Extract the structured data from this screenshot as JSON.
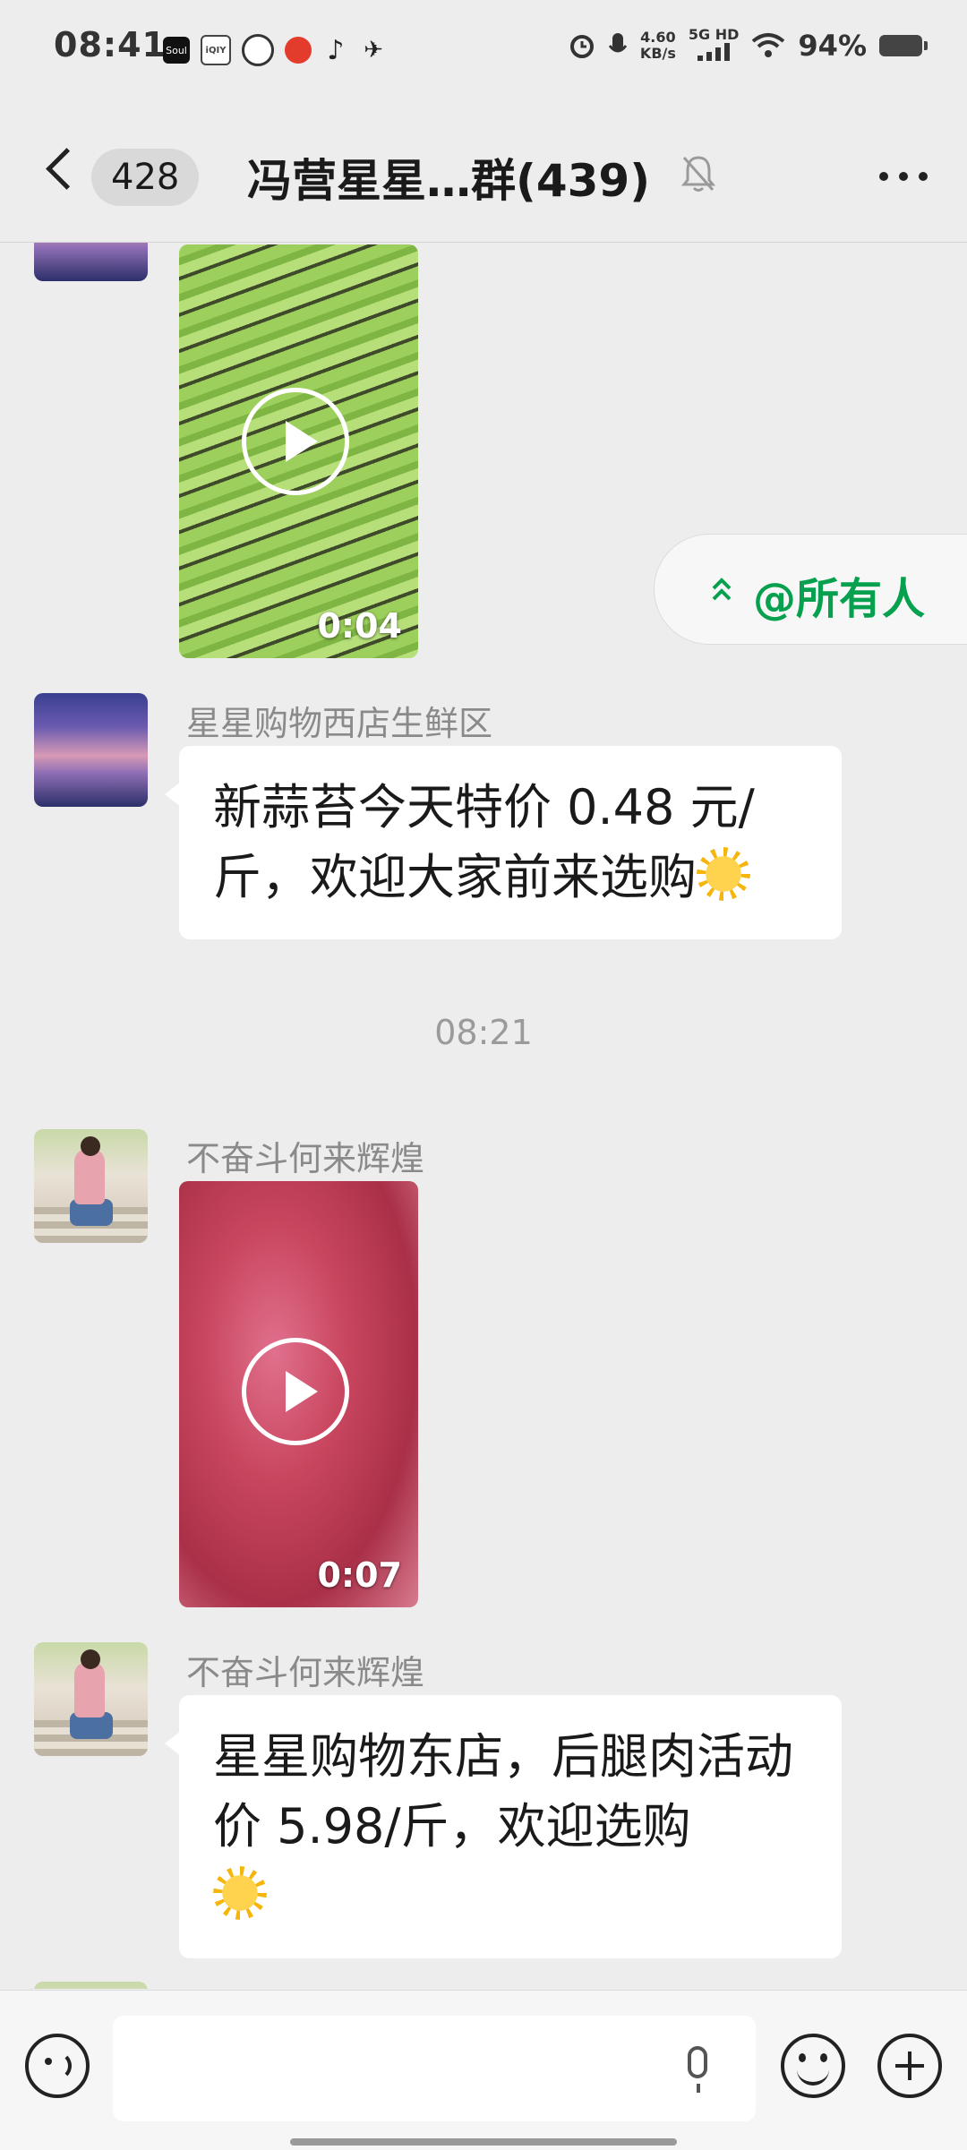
{
  "status_bar": {
    "time": "08:41",
    "network_speed_value": "4.60",
    "network_speed_unit": "KB/s",
    "network_type": "5G HD",
    "battery_percent": "94%",
    "notification_icons": [
      "soul-app-icon",
      "iqiyi-icon",
      "globe-app-icon",
      "red-app-icon",
      "tiktok-icon",
      "bird-app-icon"
    ],
    "system_icons": [
      "alarm-icon",
      "mic-icon",
      "signal-icon",
      "wifi-icon",
      "battery-icon"
    ]
  },
  "header": {
    "unread_count": "428",
    "title": "冯营星星…群(439)",
    "muted": true
  },
  "mention_banner": {
    "label": "@所有人",
    "color": "#07a04f"
  },
  "messages": [
    {
      "type": "video",
      "sender": "",
      "duration": "0:04",
      "avatar": "sky"
    },
    {
      "type": "text",
      "sender": "星星购物西店生鲜区",
      "text": "新蒜苔今天特价 0.48 元/斤，欢迎大家前来选购",
      "emoji": "sun"
    },
    {
      "type": "timestamp",
      "text": "08:21"
    },
    {
      "type": "video",
      "sender": "不奋斗何来辉煌",
      "duration": "0:07",
      "avatar": "person"
    },
    {
      "type": "text",
      "sender": "不奋斗何来辉煌",
      "text": "星星购物东店，后腿肉活动价 5.98/斤，欢迎选购",
      "emoji": "sun"
    }
  ],
  "input_bar": {
    "placeholder": ""
  },
  "colors": {
    "background": "#ededed",
    "bubble": "#ffffff",
    "accent": "#07a04f"
  }
}
